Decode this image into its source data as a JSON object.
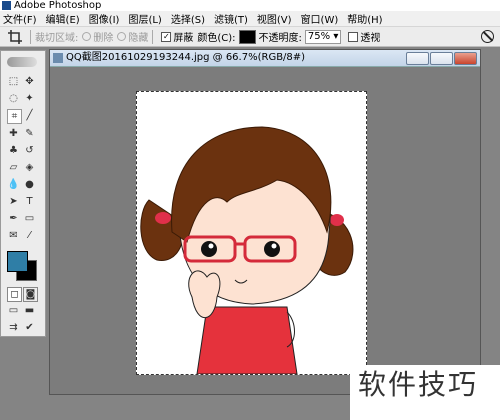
{
  "title_bar": {
    "title": "Adobe Photoshop"
  },
  "menu": [
    "文件(F)",
    "编辑(E)",
    "图像(I)",
    "图层(L)",
    "选择(S)",
    "滤镜(T)",
    "视图(V)",
    "窗口(W)",
    "帮助(H)"
  ],
  "options": {
    "cropped_area_label": "裁切区域:",
    "delete_label": "删除",
    "hide_label": "隐藏",
    "shield_label": "屏蔽",
    "color_label": "颜色(C):",
    "shield_color": "#000000",
    "opacity_label": "不透明度:",
    "opacity_value": "75%",
    "perspective_label": "透视"
  },
  "document": {
    "title": "QQ截图20161029193244.jpg @ 66.7%(RGB/8#)"
  },
  "colors": {
    "foreground": "#2f7ea6",
    "background": "#000000"
  },
  "watermark": {
    "text": "软件技巧"
  }
}
